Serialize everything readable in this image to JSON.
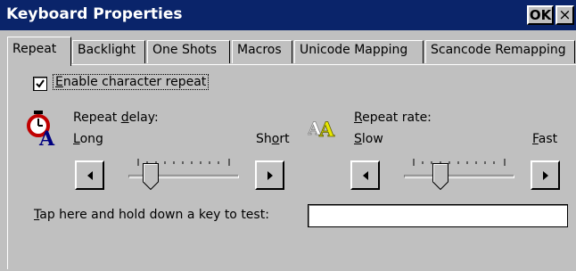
{
  "window": {
    "title": "Keyboard Properties",
    "ok_label": "OK",
    "close_label": "×"
  },
  "tabs": [
    {
      "label": "Repeat",
      "active": true
    },
    {
      "label": "Backlight"
    },
    {
      "label": "One Shots"
    },
    {
      "label": "Macros"
    },
    {
      "label": "Unicode Mapping"
    },
    {
      "label": "Scancode Remapping"
    }
  ],
  "repeat": {
    "enable_label_hotkey": "E",
    "enable_label_rest": "nable character repeat",
    "enable_checked": true,
    "delay": {
      "label_pre": "Repeat ",
      "label_hotkey": "d",
      "label_post": "elay:",
      "min_hotkey": "L",
      "min_rest": "ong",
      "max_pre": "Sh",
      "max_hotkey": "o",
      "max_post": "rt",
      "level": 0.15
    },
    "rate": {
      "label_hotkey": "R",
      "label_rest": "epeat rate:",
      "min_hotkey": "S",
      "min_rest": "low",
      "max_hotkey": "F",
      "max_rest": "ast",
      "level": 0.3
    },
    "test_hotkey": "T",
    "test_rest": "ap here and hold down a key to test:",
    "test_value": ""
  },
  "colors": {
    "title_bar": "#0a246a",
    "face": "#c0c0c0"
  },
  "icons": {
    "delay": "stopwatch-icon",
    "rate": "letters-icon"
  }
}
